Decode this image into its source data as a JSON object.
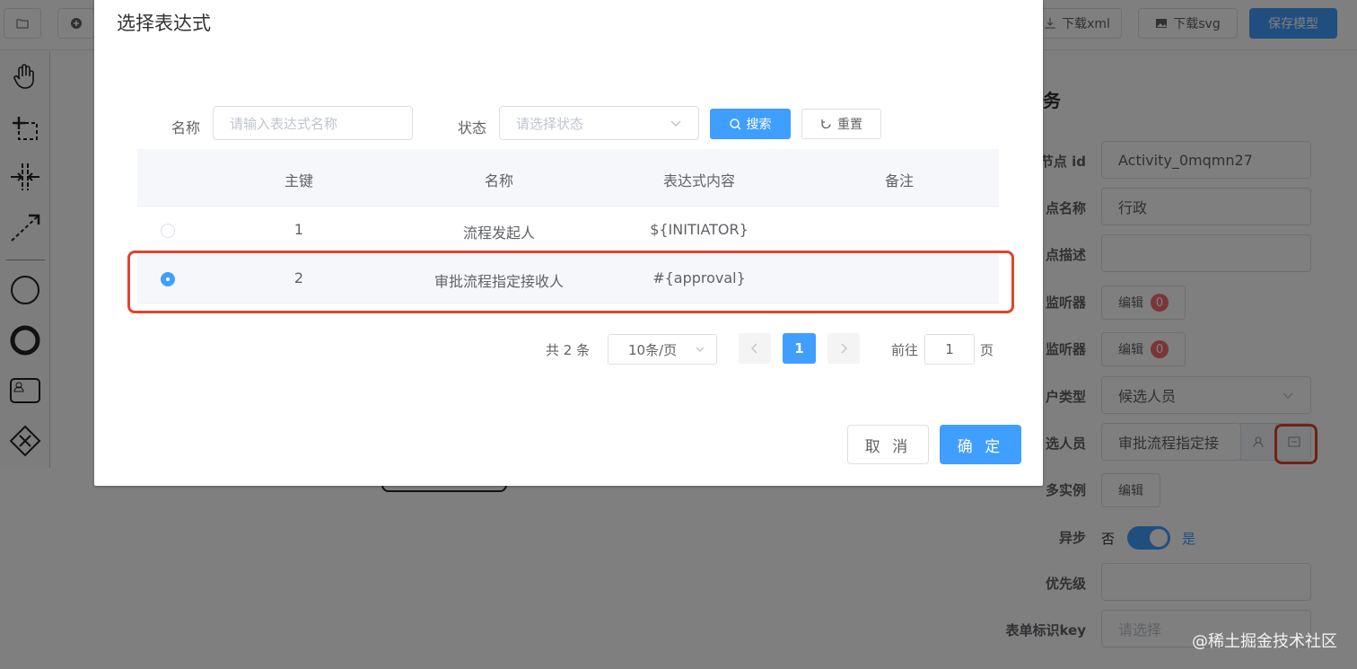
{
  "toolbar": {
    "download_xml": "下载xml",
    "download_svg": "下载svg",
    "save_model": "保存模型"
  },
  "panel": {
    "title": "务",
    "labels": {
      "node_id": "节点 id",
      "node_name": "点名称",
      "node_desc": "点描述",
      "listener1": "监听器",
      "listener2": "监听器",
      "user_type": "户类型",
      "candidate": "选人员",
      "multi_instance": "多实例",
      "async": "异步",
      "priority": "优先级",
      "form_key": "表单标识key"
    },
    "values": {
      "node_id": "Activity_0mqmn27",
      "node_name": "行政",
      "node_desc": "",
      "edit": "编辑",
      "listener_count1": "0",
      "listener_count2": "0",
      "user_type": "候选人员",
      "candidate": "审批流程指定接",
      "async_no": "否",
      "async_yes": "是",
      "priority": "",
      "form_key_placeholder": "请选择"
    }
  },
  "dialog": {
    "title": "选择表达式",
    "filter": {
      "name_label": "名称",
      "name_placeholder": "请输入表达式名称",
      "status_label": "状态",
      "status_placeholder": "请选择状态",
      "search_button": "搜索",
      "reset_button": "重置"
    },
    "table": {
      "columns": [
        "主键",
        "名称",
        "表达式内容",
        "备注"
      ],
      "rows": [
        {
          "id": "1",
          "name": "流程发起人",
          "content": "${INITIATOR}",
          "remark": "",
          "selected": false
        },
        {
          "id": "2",
          "name": "审批流程指定接收人",
          "content": "#{approval}",
          "remark": "",
          "selected": true
        }
      ]
    },
    "pagination": {
      "total": "共 2 条",
      "page_size": "10条/页",
      "current_page": "1",
      "goto_label": "前往",
      "goto_value": "1",
      "page_suffix": "页"
    },
    "cancel_button": "取 消",
    "confirm_button": "确 定"
  },
  "watermark": "@稀土掘金技术社区",
  "colors": {
    "primary": "#409eff",
    "highlight": "#e0452b",
    "badge": "#f56c6c"
  }
}
